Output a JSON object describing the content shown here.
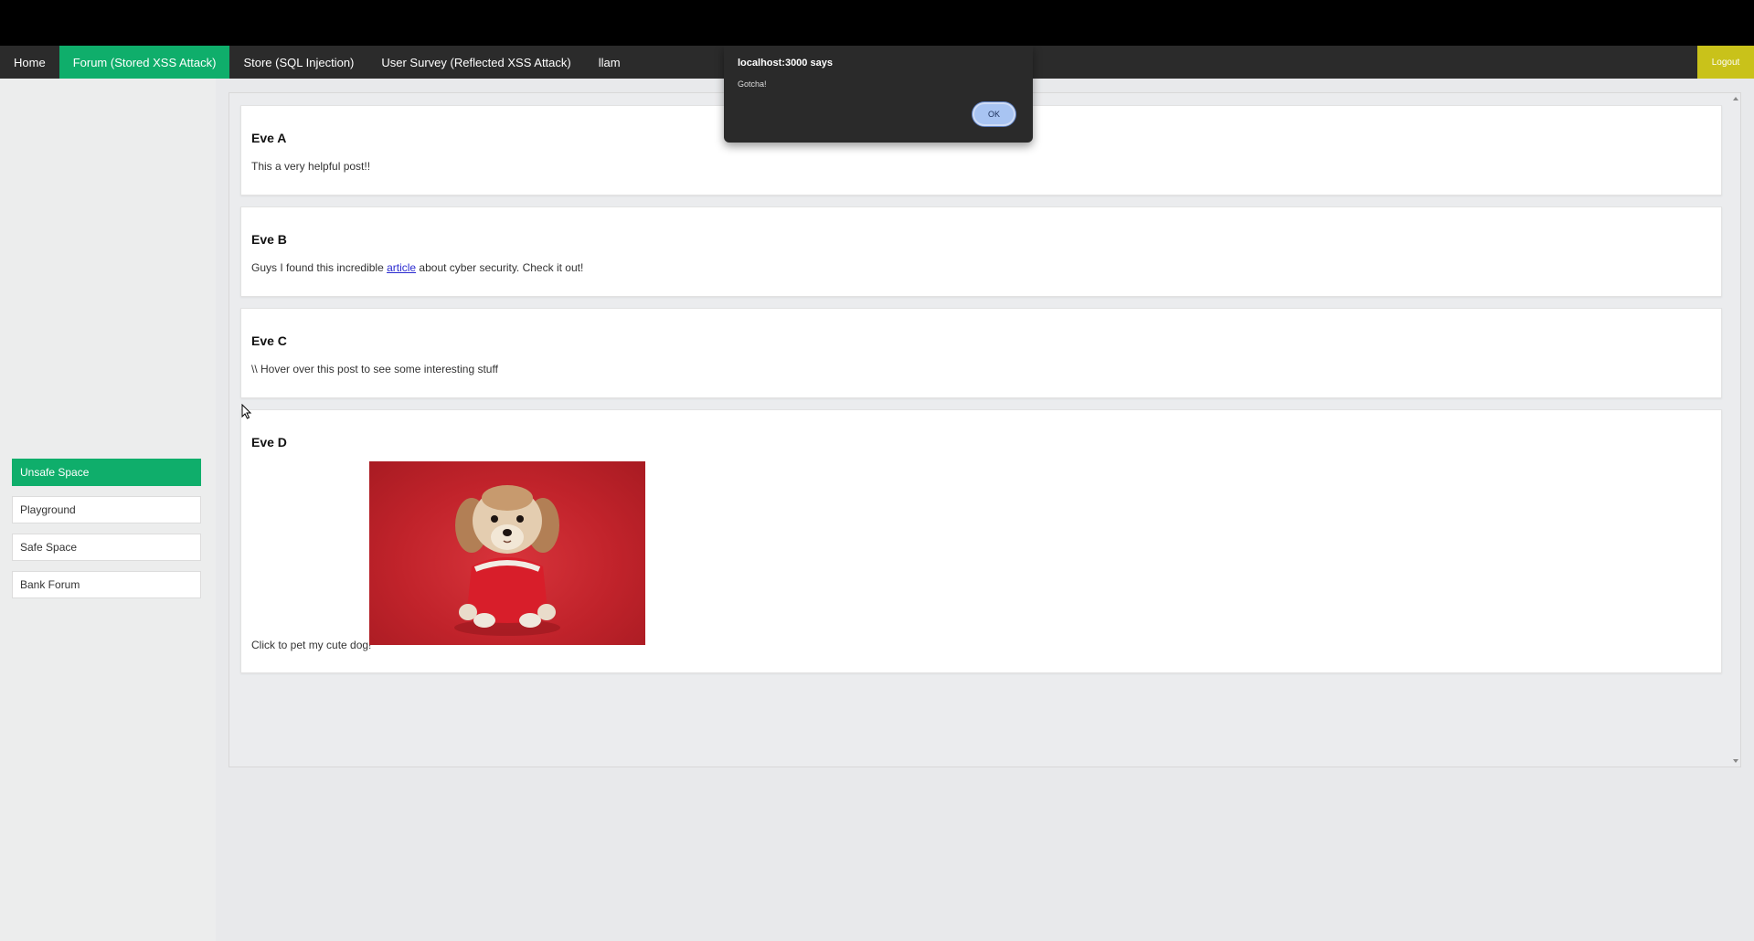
{
  "nav": {
    "items": [
      {
        "label": "Home"
      },
      {
        "label": "Forum (Stored XSS Attack)"
      },
      {
        "label": "Store (SQL Injection)"
      },
      {
        "label": "User Survey (Reflected XSS Attack)"
      },
      {
        "label": "llam"
      }
    ],
    "logout": "Logout"
  },
  "sidebar": {
    "items": [
      {
        "label": "Unsafe Space"
      },
      {
        "label": "Playground"
      },
      {
        "label": "Safe Space"
      },
      {
        "label": "Bank Forum"
      }
    ]
  },
  "posts": [
    {
      "author": "Eve A",
      "text": "This a very helpful post!!"
    },
    {
      "author": "Eve B",
      "text_before": "Guys I found this incredible ",
      "link": "article",
      "text_after": " about cyber security. Check it out!"
    },
    {
      "author": "Eve C",
      "text": "\\\\ Hover over this post to see some interesting stuff"
    },
    {
      "author": "Eve D",
      "text": "Click to pet my cute dog!"
    }
  ],
  "dialog": {
    "title": "localhost:3000 says",
    "message": "Gotcha!",
    "ok": "OK"
  },
  "colors": {
    "accent_green": "#0fae6b",
    "logout_yellow": "#c9c21a",
    "navbar": "#2b2b2b",
    "link": "#2b2bd0"
  }
}
